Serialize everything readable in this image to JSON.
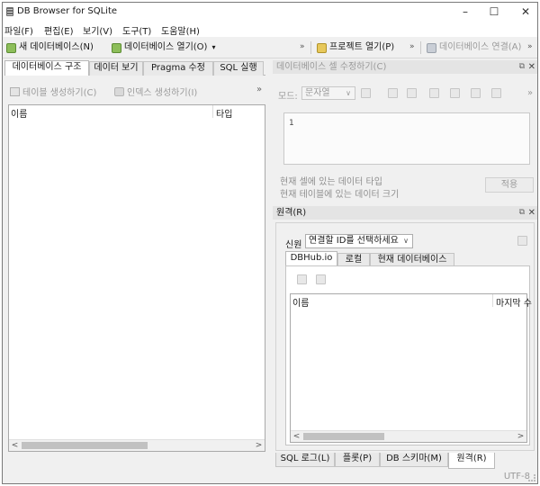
{
  "window": {
    "title": "DB Browser for SQLite",
    "controls": {
      "minimize": "–",
      "maximize": "☐",
      "close": "✕"
    }
  },
  "menu": [
    "파일(F)",
    "편집(E)",
    "보기(V)",
    "도구(T)",
    "도움말(H)"
  ],
  "toolbar": {
    "new_db": "새 데이터베이스(N)",
    "open_db": "데이터베이스 열기(O)",
    "overflow": "»",
    "open_project": "프로젝트 열기(P)",
    "overflow2": "»",
    "attach_db": "데이터베이스 연결(A)",
    "overflow3": "»"
  },
  "left_tabs": [
    "데이터베이스 구조",
    "데이터 보기",
    "Pragma 수정",
    "SQL 실행"
  ],
  "structure": {
    "create_table": "테이블 생성하기(C)",
    "create_index": "인덱스 생성하기(I)",
    "overflow": "»",
    "col_name": "이름",
    "col_type": "타입",
    "scroll_left": "<",
    "scroll_right": ">"
  },
  "edit_cell": {
    "title": "데이터베이스 셀 수정하기(C)",
    "mode_label": "모드:",
    "mode_value": "문자열",
    "overflow": "»",
    "content": "1",
    "cell_type_info": "현재 셀에 있는 데이터 타입",
    "cell_size_info": "현재 테이블에 있는 데이터 크기",
    "apply": "적용"
  },
  "remote": {
    "title": "원격(R)",
    "id_label": "신원",
    "id_select": "연결할 ID를 선택하세요",
    "tabs": [
      "DBHub.io",
      "로컬",
      "현재 데이터베이스"
    ],
    "col_name": "이름",
    "col_last": "마지막 수",
    "scroll_left": "<",
    "scroll_right": ">"
  },
  "bottom_tabs": [
    "SQL 로그(L)",
    "플롯(P)",
    "DB 스키마(M)",
    "원격(R)"
  ],
  "status": {
    "encoding": "UTF-8"
  }
}
